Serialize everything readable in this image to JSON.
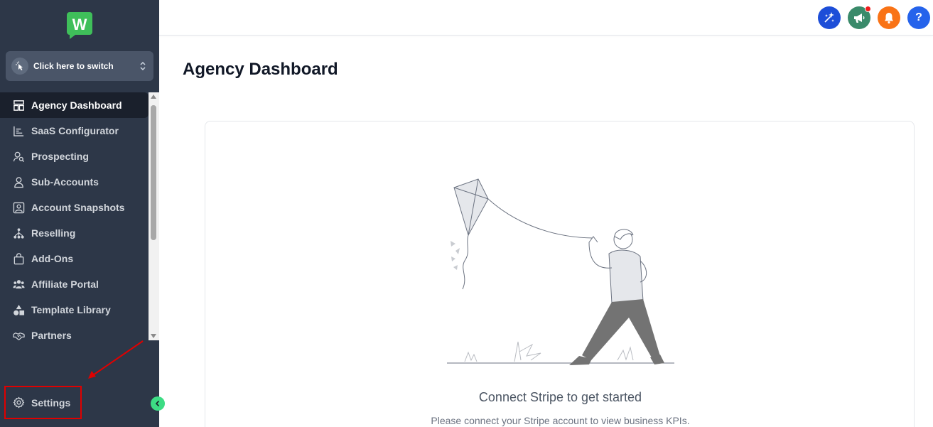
{
  "brand": {
    "logo_letter": "W",
    "logo_color": "#3fbf5a"
  },
  "switcher": {
    "label": "Click here to switch"
  },
  "sidebar": {
    "items": [
      {
        "label": "Agency Dashboard",
        "icon": "dashboard-icon",
        "active": true
      },
      {
        "label": "SaaS Configurator",
        "icon": "bar-chart-icon"
      },
      {
        "label": "Prospecting",
        "icon": "user-search-icon"
      },
      {
        "label": "Sub-Accounts",
        "icon": "user-icon"
      },
      {
        "label": "Account Snapshots",
        "icon": "snapshot-icon"
      },
      {
        "label": "Reselling",
        "icon": "network-icon"
      },
      {
        "label": "Add-Ons",
        "icon": "bag-icon"
      },
      {
        "label": "Affiliate Portal",
        "icon": "users-icon"
      },
      {
        "label": "Template Library",
        "icon": "shapes-icon"
      },
      {
        "label": "Partners",
        "icon": "handshake-icon"
      }
    ],
    "settings_label": "Settings"
  },
  "topbar": {
    "help_label": "?"
  },
  "main": {
    "title": "Agency Dashboard",
    "empty_state": {
      "title": "Connect Stripe to get started",
      "subtitle": "Please connect your Stripe account to view business KPIs."
    }
  },
  "colors": {
    "sidebar_bg": "#2d3748",
    "active_item_bg": "#1a202c",
    "highlight_red": "#e00000",
    "accent_green": "#3ddc84"
  }
}
